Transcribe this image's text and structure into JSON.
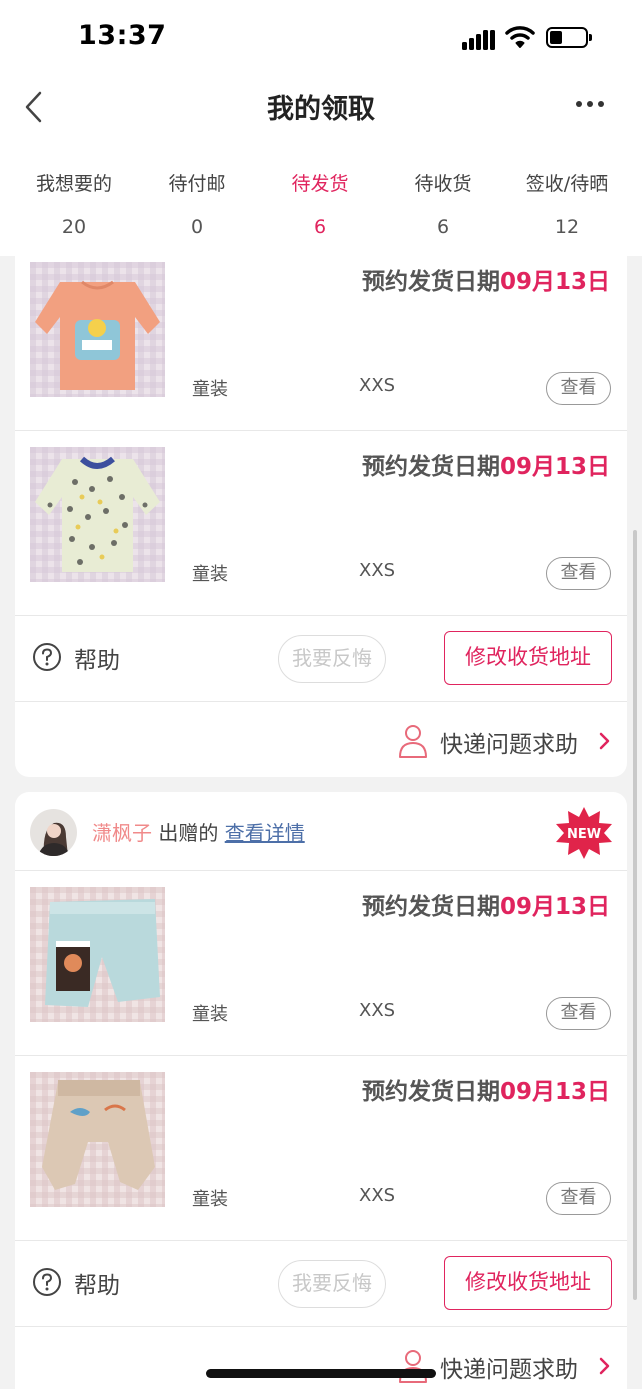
{
  "status_bar": {
    "time": "13:37"
  },
  "header": {
    "title": "我的领取"
  },
  "tabs": [
    {
      "label": "我想要的",
      "count": "20"
    },
    {
      "label": "待付邮",
      "count": "0"
    },
    {
      "label": "待发货",
      "count": "6",
      "active": true
    },
    {
      "label": "待收货",
      "count": "6"
    },
    {
      "label": "签收/待晒",
      "count": "12"
    }
  ],
  "common": {
    "ship_prefix": "预约发货日期",
    "view_label": "查看",
    "help_label": "帮助",
    "regret_label": "我要反悔",
    "address_label": "修改收货地址",
    "courier_label": "快递问题求助",
    "new_badge": "NEW"
  },
  "orders": [
    {
      "items": [
        {
          "ship_date": "09月13日",
          "category": "童装",
          "size": "XXS",
          "icon": "pink-sweatshirt"
        },
        {
          "ship_date": "09月13日",
          "category": "童装",
          "size": "XXS",
          "icon": "patterned-shirt"
        }
      ]
    },
    {
      "giver": {
        "name": "潇枫子",
        "action": "出赠的",
        "link": "查看详情"
      },
      "items": [
        {
          "ship_date": "09月13日",
          "category": "童装",
          "size": "XXS",
          "icon": "denim-pants"
        },
        {
          "ship_date": "09月13日",
          "category": "童装",
          "size": "XXS",
          "icon": "beige-pants"
        }
      ]
    }
  ],
  "colors": {
    "accent": "#e0245e",
    "link": "#4d6fa8",
    "giver_name": "#f08a8a"
  }
}
